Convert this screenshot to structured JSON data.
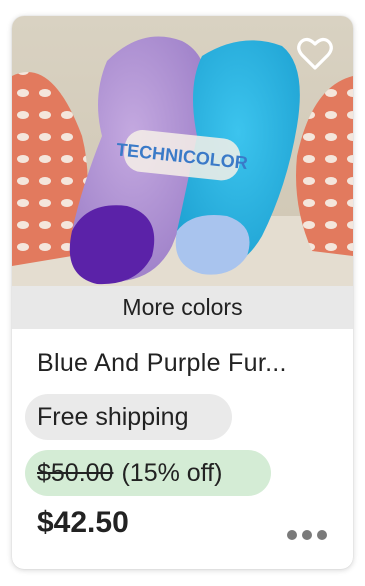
{
  "listing": {
    "more_colors_label": "More colors",
    "title": "Blue And Purple Fur...",
    "free_shipping_label": "Free shipping",
    "original_price": "$50.00",
    "discount": "(15% off)",
    "price": "$42.50",
    "image_logo_text": "TECHNICOLOR"
  },
  "colors": {
    "sale_badge_bg": "#d4ecd5",
    "shipping_badge_bg": "#eaeaea",
    "text": "#222222"
  },
  "icons": {
    "favorite": "heart-outline-icon",
    "more": "more-options-dots-icon"
  }
}
